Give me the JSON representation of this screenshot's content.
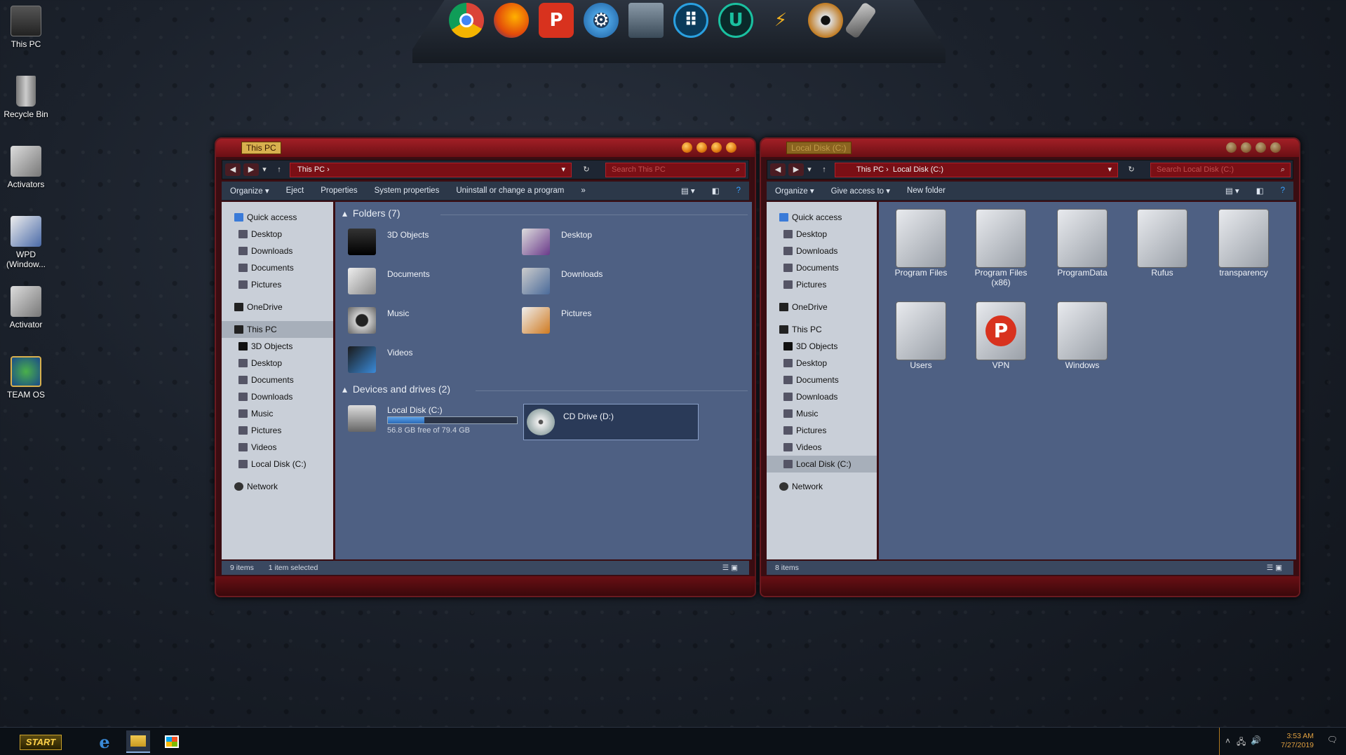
{
  "desktop": {
    "icons": [
      {
        "label": "This PC"
      },
      {
        "label": "Recycle Bin"
      },
      {
        "label": "Activators"
      },
      {
        "label": "WPD (Window..."
      },
      {
        "label": "Activator"
      },
      {
        "label": "TEAM OS"
      }
    ]
  },
  "dock": {
    "apps": [
      {
        "name": "chrome-icon"
      },
      {
        "name": "firefox-icon"
      },
      {
        "name": "psiphon-icon"
      },
      {
        "name": "settings-gear-icon"
      },
      {
        "name": "system-monitor-icon"
      },
      {
        "name": "launcher-icon"
      },
      {
        "name": "uplay-icon"
      },
      {
        "name": "lightning-icon"
      },
      {
        "name": "disc-icon"
      },
      {
        "name": "usb-icon"
      }
    ]
  },
  "win1": {
    "title": "This PC",
    "address": "This PC",
    "search_placeholder": "Search This PC",
    "commands": [
      "Organize",
      "Eject",
      "Properties",
      "System properties",
      "Uninstall or change a program",
      "»"
    ],
    "nav": {
      "quick_access": "Quick access",
      "qa_items": [
        "Desktop",
        "Downloads",
        "Documents",
        "Pictures"
      ],
      "onedrive": "OneDrive",
      "thispc": "This PC",
      "pc_items": [
        "3D Objects",
        "Desktop",
        "Documents",
        "Downloads",
        "Music",
        "Pictures",
        "Videos",
        "Local Disk (C:)"
      ],
      "network": "Network"
    },
    "folders_header": "Folders (7)",
    "folders": [
      "3D Objects",
      "Desktop",
      "Documents",
      "Downloads",
      "Music",
      "Pictures",
      "Videos"
    ],
    "drives_header": "Devices and drives (2)",
    "drives": [
      {
        "name": "Local Disk (C:)",
        "free": "56.8 GB free of 79.4 GB",
        "used_fraction": 0.285
      },
      {
        "name": "CD Drive (D:)"
      }
    ],
    "status_items": "9 items",
    "status_selected": "1 item selected"
  },
  "win2": {
    "title": "Local Disk (C:)",
    "address_root": "This PC",
    "address_leaf": "Local Disk (C:)",
    "search_placeholder": "Search Local Disk (C:)",
    "commands": [
      "Organize",
      "Give access to",
      "New folder"
    ],
    "nav": {
      "quick_access": "Quick access",
      "qa_items": [
        "Desktop",
        "Downloads",
        "Documents",
        "Pictures"
      ],
      "onedrive": "OneDrive",
      "thispc": "This PC",
      "pc_items": [
        "3D Objects",
        "Desktop",
        "Documents",
        "Downloads",
        "Music",
        "Pictures",
        "Videos",
        "Local Disk (C:)"
      ],
      "network": "Network"
    },
    "folders": [
      "Program Files",
      "Program Files (x86)",
      "ProgramData",
      "Rufus",
      "transparency",
      "Users",
      "VPN",
      "Windows"
    ],
    "status_items": "8 items"
  },
  "taskbar": {
    "start": "START",
    "time": "3:53 AM",
    "date": "7/27/2019"
  },
  "colors": {
    "accent_red": "#7a0f15",
    "content_blue": "#4e6083",
    "gold": "#d8b04e"
  }
}
